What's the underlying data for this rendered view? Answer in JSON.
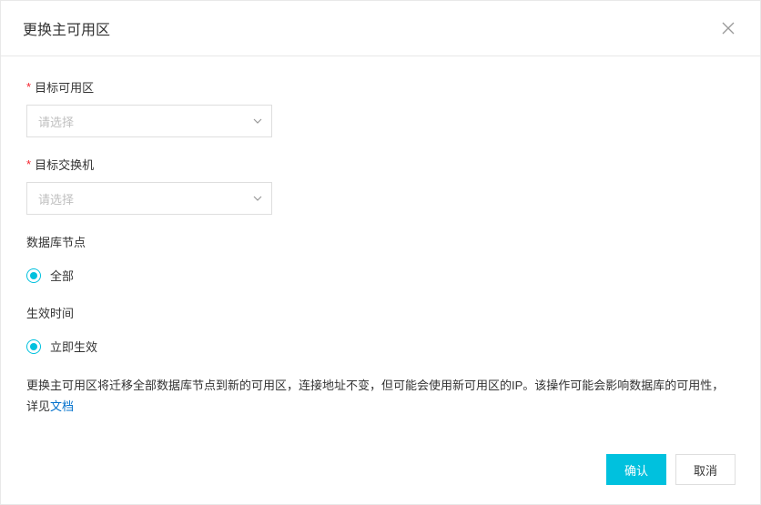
{
  "dialog": {
    "title": "更换主可用区"
  },
  "fields": {
    "target_zone": {
      "label": "目标可用区",
      "placeholder": "请选择"
    },
    "target_vswitch": {
      "label": "目标交换机",
      "placeholder": "请选择"
    }
  },
  "db_nodes": {
    "label": "数据库节点",
    "option_all": "全部"
  },
  "effective_time": {
    "label": "生效时间",
    "option_immediate": "立即生效"
  },
  "help": {
    "text_before": "更换主可用区将迁移全部数据库节点到新的可用区，连接地址不变，但可能会使用新可用区的IP。该操作可能会影响数据库的可用性，详见",
    "link_text": "文档"
  },
  "buttons": {
    "confirm": "确认",
    "cancel": "取消"
  }
}
